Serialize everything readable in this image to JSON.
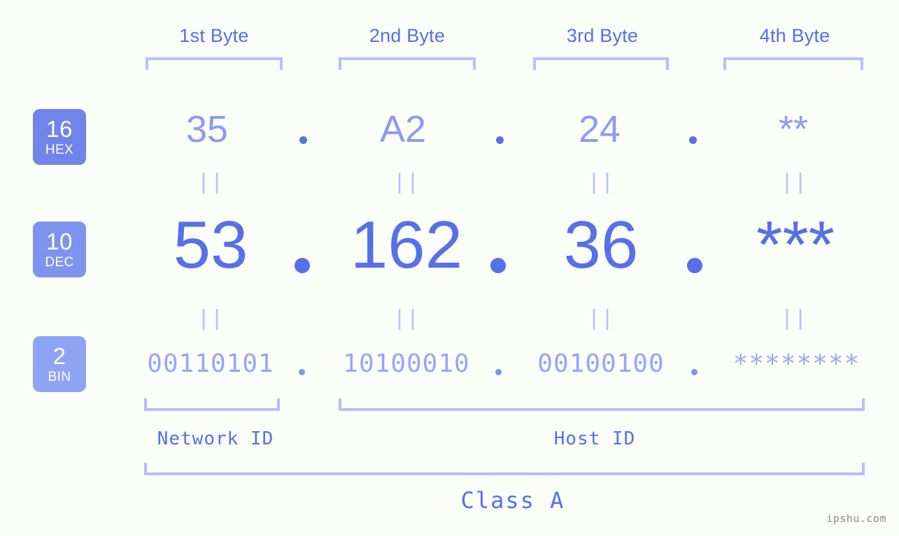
{
  "page": {
    "background_color": "#fbfdf8",
    "accent_color": "#5570e8",
    "light_accent_color": "#b6c0fb"
  },
  "headers": [
    {
      "label": "1st Byte"
    },
    {
      "label": "2nd Byte"
    },
    {
      "label": "3rd Byte"
    },
    {
      "label": "4th Byte"
    }
  ],
  "rows": [
    {
      "badge_number": "16",
      "badge_abbr": "HEX",
      "badge_color": "#7084ea",
      "values": [
        "35",
        "A2",
        "24",
        "**"
      ]
    },
    {
      "badge_number": "10",
      "badge_abbr": "DEC",
      "badge_color": "#7f93ee",
      "values": [
        "53",
        "162",
        "36",
        "***"
      ]
    },
    {
      "badge_number": "2",
      "badge_abbr": "BIN",
      "badge_color": "#8fa3f5",
      "values": [
        "00110101",
        "10100010",
        "00100100",
        "********"
      ]
    }
  ],
  "connector_symbol": "||",
  "separator_symbol": ".",
  "footer": {
    "network_id_label": "Network ID",
    "host_id_label": "Host ID",
    "class_label": "Class A"
  },
  "watermark": "ipshu.com"
}
